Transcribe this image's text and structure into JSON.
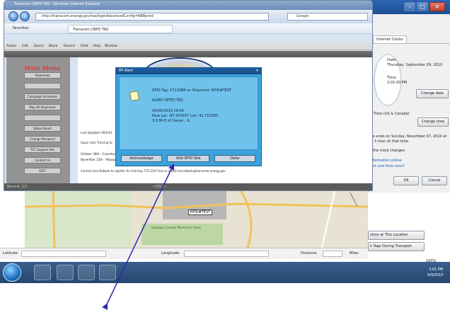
{
  "ie": {
    "title": "Transcom CBPO TAS - Windows Internet Explorer",
    "address": "http://transcom.energy.gov/tas/loginAdvancedConfig=BBBprod",
    "search_placeholder": "Google",
    "favorites_label": "Favorites",
    "tab_label": "Transcom CBPO TAS"
  },
  "app_menu": [
    "Action",
    "Edit",
    "Query",
    "Block",
    "Record",
    "Field",
    "Help",
    "Window"
  ],
  "main_menu": {
    "title": "Main Menu",
    "buttons": [
      "Shipments",
      "",
      "Campaign Schedules",
      "Map All Shipments",
      "",
      "Status Board",
      "Change Password",
      "TCC Support Site",
      "Contact Us",
      "EXIT"
    ]
  },
  "content": {
    "lines": [
      "Last Updated: 09/03/1",
      "Super User Training Sc",
      "October 28th - Columbus, OH (Eastern Regional Training)",
      "November 13th - Albuquerque, NM",
      "Contact Lora Roback to register for training. 575-234-7xxx or email lora.roback@transcom.energy.gov"
    ]
  },
  "status_bar": {
    "left": "Record: 1/1",
    "right": "<OSC>"
  },
  "rf_alert": {
    "title": "RF Alert",
    "line1": "RFID Tag: 5712088    on Shipment: RFID#TEST",
    "line2": "ALERT DETECTED",
    "line3": "09/08/2010 14:00",
    "line4": "New Lat: -87.979167 Lon: 41.712500",
    "line5": "3.6 Mi   E of Darien         , IL",
    "btn_ack": "Acknowledge",
    "btn_visit": "Visit RFID Site",
    "btn_defer": "Defer"
  },
  "clock_dialog": {
    "tab": "Internet Clocks",
    "date_label": "Date:",
    "date_value": "Thursday, September 09, 2010",
    "time_label": "Time:",
    "time_value": "3:01:00 PM",
    "change_date_btn": "Change date",
    "timezone": "al Time (US & Canada)",
    "change_tz_btn": "Change time",
    "dst_text": "me ends on Sunday, November 07, 2010 at",
    "dst_text2": "ck 1 hour at that time.",
    "notify": "n the clock changes",
    "link1": "information online",
    "link2": "lock and time zone?",
    "ok": "OK",
    "cancel": "Cancel"
  },
  "map": {
    "rfid_label": "RFID#TEST",
    "park_label": "Dupage County Memorial Gard",
    "history_btn": "story at This Location",
    "transport_btn": "k Tags During Transport"
  },
  "bottom_bar": {
    "latitude": "Latitude:",
    "longitude": "Longitude:",
    "distance": "Distance:",
    "miles": "Miles"
  },
  "tray": {
    "zoom": "100%",
    "time": "3:01 PM",
    "date": "9/9/2010"
  },
  "colors": {
    "dialog_blue": "#3aa2dc",
    "menu_red": "#e03b3b",
    "arrow": "#2a2ab0"
  }
}
